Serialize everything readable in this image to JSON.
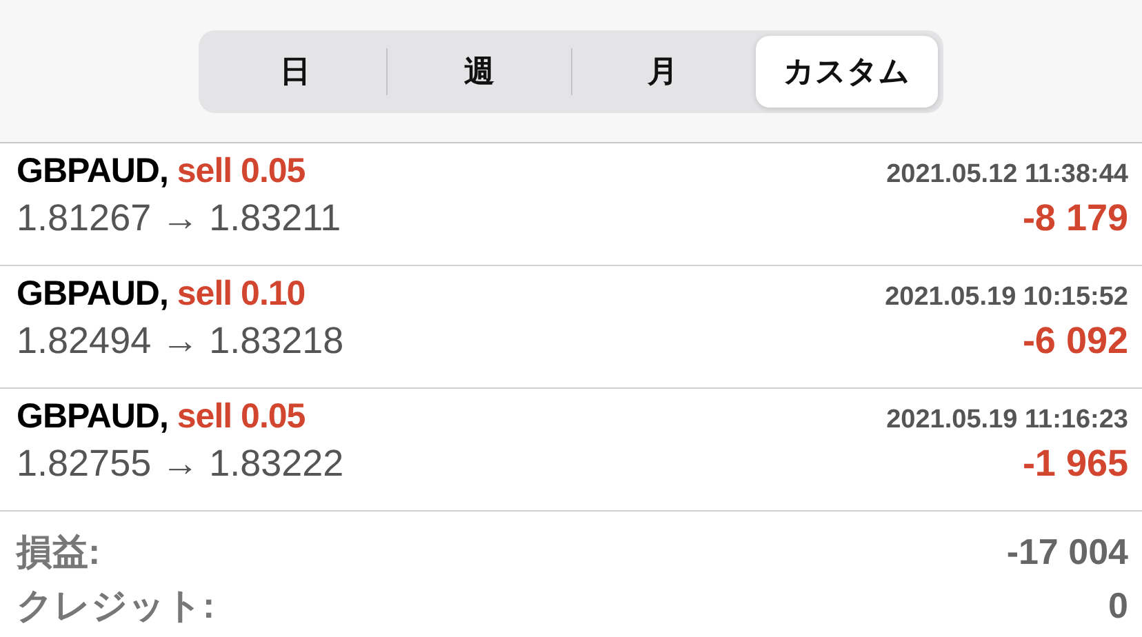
{
  "tabs": [
    {
      "label": "日",
      "selected": false
    },
    {
      "label": "週",
      "selected": false
    },
    {
      "label": "月",
      "selected": false
    },
    {
      "label": "カスタム",
      "selected": true
    }
  ],
  "trades": [
    {
      "symbol": "GBPAUD,",
      "order": "sell 0.05",
      "time": "2021.05.12 11:38:44",
      "prices": "1.81267 → 1.83211",
      "profit": "-8 179"
    },
    {
      "symbol": "GBPAUD,",
      "order": "sell 0.10",
      "time": "2021.05.19 10:15:52",
      "prices": "1.82494 → 1.83218",
      "profit": "-6 092"
    },
    {
      "symbol": "GBPAUD,",
      "order": "sell 0.05",
      "time": "2021.05.19 11:16:23",
      "prices": "1.82755 → 1.83222",
      "profit": "-1 965"
    }
  ],
  "summary": [
    {
      "label": "損益:",
      "value": "-17 004"
    },
    {
      "label": "クレジット:",
      "value": "0"
    }
  ]
}
